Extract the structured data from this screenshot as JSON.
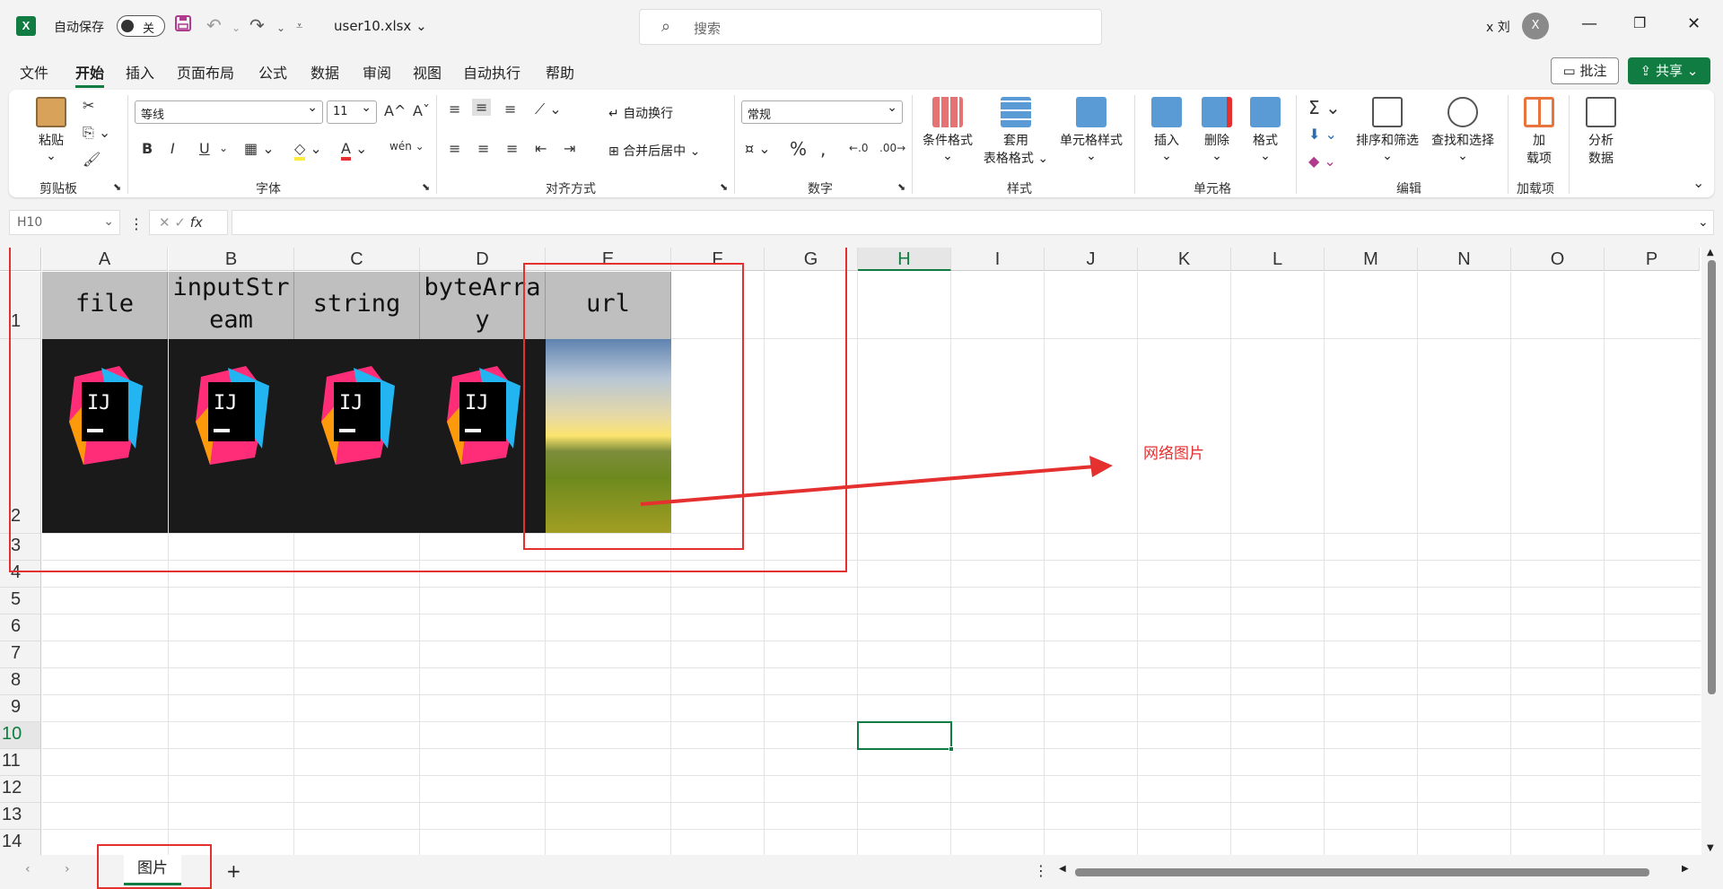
{
  "titlebar": {
    "app_icon": "excel-icon",
    "autosave_label": "自动保存",
    "autosave_state": "关",
    "filename": "user10.xlsx",
    "search_placeholder": "搜索",
    "user_name": "x 刘",
    "avatar_initial": "X"
  },
  "menu": {
    "items": [
      "文件",
      "开始",
      "插入",
      "页面布局",
      "公式",
      "数据",
      "审阅",
      "视图",
      "自动执行",
      "帮助"
    ],
    "active": "开始",
    "comment_label": "批注",
    "share_label": "共享"
  },
  "ribbon": {
    "clipboard": {
      "paste": "粘贴",
      "group": "剪贴板"
    },
    "font": {
      "name": "等线",
      "size": "11",
      "group": "字体",
      "bold": "B",
      "italic": "I",
      "underline": "U"
    },
    "alignment": {
      "wrap": "自动换行",
      "merge": "合并后居中",
      "group": "对齐方式"
    },
    "number": {
      "format": "常规",
      "group": "数字"
    },
    "styles": {
      "conditional": "条件格式",
      "table_line1": "套用",
      "table_line2": "表格格式",
      "cell_styles": "单元格样式",
      "group": "样式"
    },
    "cells": {
      "insert": "插入",
      "delete": "删除",
      "format": "格式",
      "group": "单元格"
    },
    "editing": {
      "sort": "排序和筛选",
      "find": "查找和选择",
      "group": "编辑"
    },
    "addins": {
      "line1": "加",
      "line2": "载项",
      "group": "加载项"
    },
    "analyze": {
      "line1": "分析",
      "line2": "数据"
    }
  },
  "formula_bar": {
    "name_box": "H10",
    "fx": "fx",
    "value": ""
  },
  "grid": {
    "columns": [
      "A",
      "B",
      "C",
      "D",
      "E",
      "F",
      "G",
      "H",
      "I",
      "J",
      "K",
      "L",
      "M",
      "N",
      "O",
      "P"
    ],
    "rows": [
      "1",
      "2",
      "3",
      "4",
      "5",
      "6",
      "7",
      "8",
      "9",
      "10",
      "11",
      "12",
      "13",
      "14"
    ],
    "selected_cell": "H10",
    "header_cells": [
      "file",
      "inputStream",
      "string",
      "byteArray",
      "url"
    ],
    "row2_images": [
      "intellij-logo",
      "intellij-logo",
      "intellij-logo",
      "intellij-logo",
      "landscape-photo"
    ]
  },
  "annotation": {
    "label": "网络图片",
    "color": "#e53030"
  },
  "sheet_tabs": {
    "active": "图片",
    "add": "+"
  },
  "colors": {
    "accent": "#107c41",
    "header_fill": "#bfbfbf",
    "annotation_red": "#e53030"
  }
}
